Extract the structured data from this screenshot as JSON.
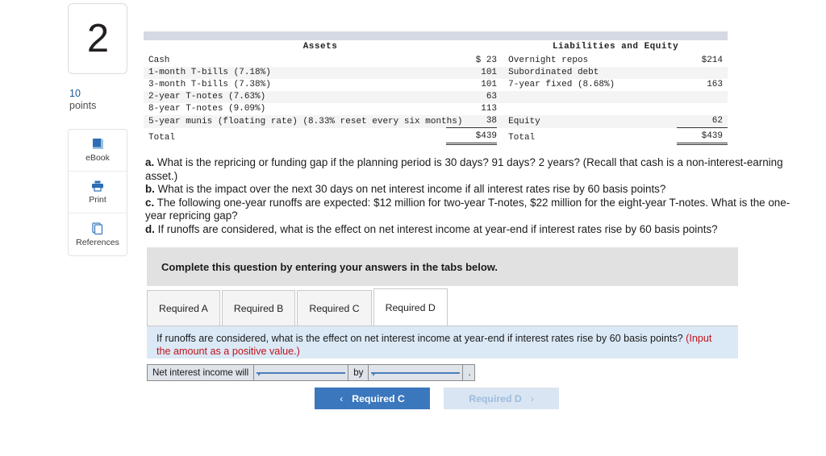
{
  "question": {
    "number": "2",
    "points_value": "10",
    "points_label": "points"
  },
  "tools": [
    {
      "label": "eBook",
      "icon": "book-icon"
    },
    {
      "label": "Print",
      "icon": "printer-icon"
    },
    {
      "label": "References",
      "icon": "pages-icon"
    }
  ],
  "balance_sheet": {
    "assets_header": "Assets",
    "liabilities_header": "Liabilities and Equity",
    "rows": [
      {
        "asset_label": "Cash",
        "asset_value": "$ 23",
        "liab_label": "Overnight repos",
        "liab_value": "$214"
      },
      {
        "asset_label": "1-month T-bills (7.18%)",
        "asset_value": "101",
        "liab_label": "Subordinated debt",
        "liab_value": ""
      },
      {
        "asset_label": "3-month T-bills (7.38%)",
        "asset_value": "101",
        "liab_label": "7-year fixed (8.68%)",
        "liab_value": "163"
      },
      {
        "asset_label": "2-year T-notes (7.63%)",
        "asset_value": "63",
        "liab_label": "",
        "liab_value": ""
      },
      {
        "asset_label": "8-year T-notes (9.09%)",
        "asset_value": "113",
        "liab_label": "",
        "liab_value": ""
      },
      {
        "asset_label": "5-year munis (floating rate) (8.33% reset every six months)",
        "asset_value": "38",
        "liab_label": "Equity",
        "liab_value": "62"
      }
    ],
    "total_row": {
      "asset_label": "Total",
      "asset_value": "$439",
      "liab_label": "Total",
      "liab_value": "$439"
    }
  },
  "question_parts": {
    "a_marker": "a.",
    "a_text": " What is the repricing or funding gap if the planning period is 30 days? 91 days? 2 years? (Recall that cash is a non-interest-earning asset.)",
    "b_marker": "b.",
    "b_text": " What is the impact over the next 30 days on net interest income if all interest rates rise by 60 basis points?",
    "c_marker": "c.",
    "c_text": " The following one-year runoffs are expected: $12 million for two-year T-notes, $22 million for the eight-year T-notes. What is the one-year repricing gap?",
    "d_marker": "d.",
    "d_text": " If runoffs are considered, what is the effect on net interest income at year-end if interest rates rise by 60 basis points?"
  },
  "complete_banner": {
    "text": "Complete this question by entering your answers in the tabs below."
  },
  "tabs": [
    {
      "label": "Required A",
      "active": false
    },
    {
      "label": "Required B",
      "active": false
    },
    {
      "label": "Required C",
      "active": false
    },
    {
      "label": "Required D",
      "active": true
    }
  ],
  "prompt": {
    "main_text": "If runoffs are considered, what is the effect on net interest income at year-end if interest rates rise by 60 basis points? ",
    "note_text": "(Input the amount as a positive value.)"
  },
  "answer_row": {
    "label": "Net interest income will",
    "field1_value": "",
    "field1_placeholder": "",
    "connector": "by",
    "field2_value": "",
    "field2_placeholder": "",
    "trailing": "."
  },
  "nav": {
    "prev_chevron": "‹",
    "prev_label": "Required C",
    "next_label": "Required D",
    "next_chevron": "›"
  },
  "colors": {
    "accent_blue": "#3b77bd",
    "panel_blue": "#dbe9f6",
    "note_red": "#c0131a",
    "table_header_bar": "#d4d9e3",
    "points_blue": "#1c5592"
  }
}
